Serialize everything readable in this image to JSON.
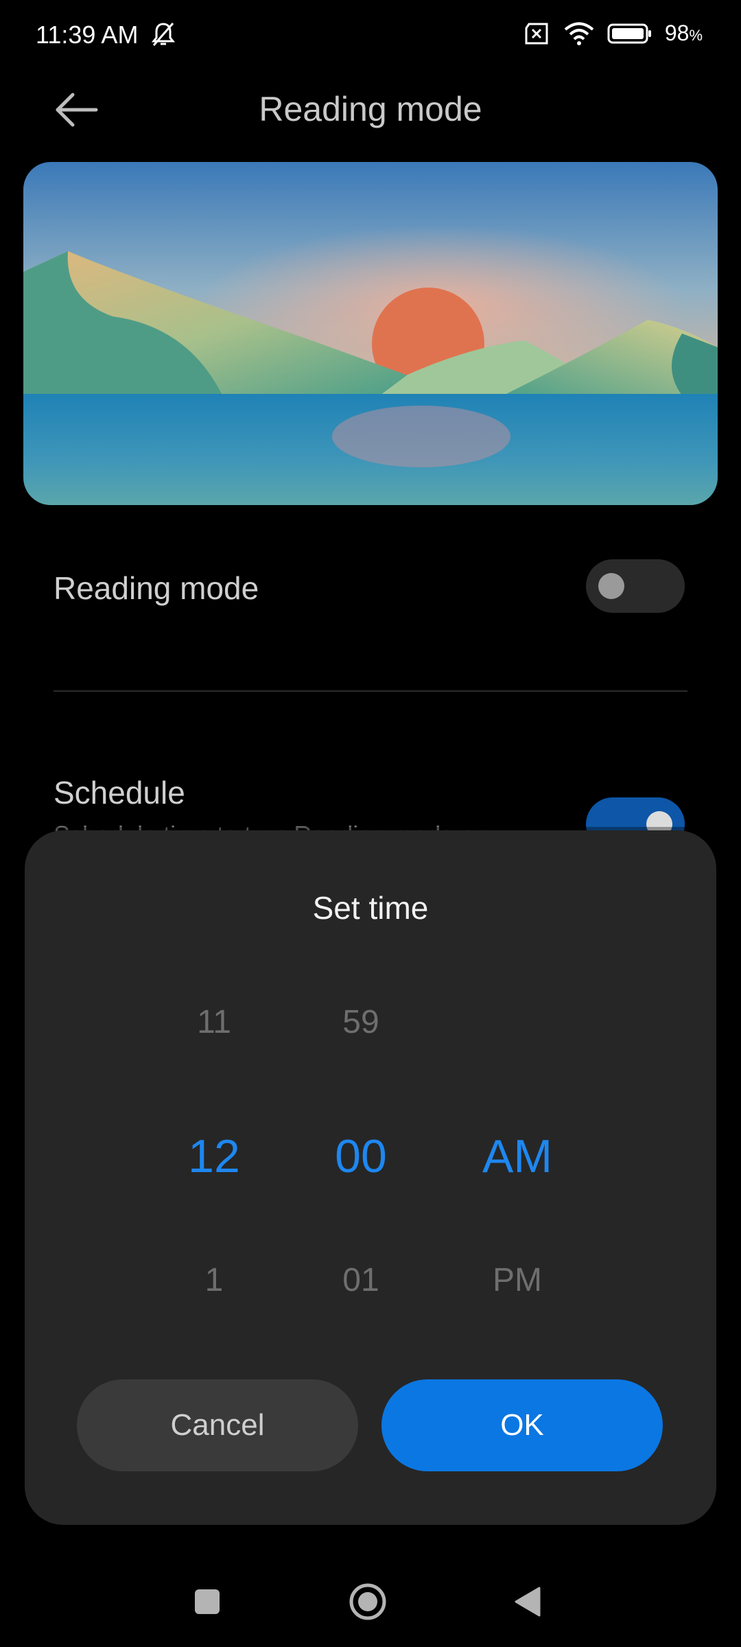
{
  "status_bar": {
    "time": "11:39 AM",
    "battery_percent": "98",
    "battery_unit": "%"
  },
  "header": {
    "title": "Reading mode"
  },
  "settings": {
    "reading_mode": {
      "label": "Reading mode",
      "enabled": false
    },
    "schedule": {
      "label": "Schedule",
      "subtitle": "Schedule time to turn Reading mode on",
      "enabled": true
    }
  },
  "dialog": {
    "title": "Set time",
    "hour": {
      "prev": "11",
      "selected": "12",
      "next": "1"
    },
    "minute": {
      "prev": "59",
      "selected": "00",
      "next": "01"
    },
    "period": {
      "prev": "",
      "selected": "AM",
      "next": "PM"
    },
    "cancel_label": "Cancel",
    "ok_label": "OK"
  },
  "colors": {
    "accent": "#1e87f0",
    "ok_button": "#0b77e3",
    "dialog_bg": "#262626"
  }
}
